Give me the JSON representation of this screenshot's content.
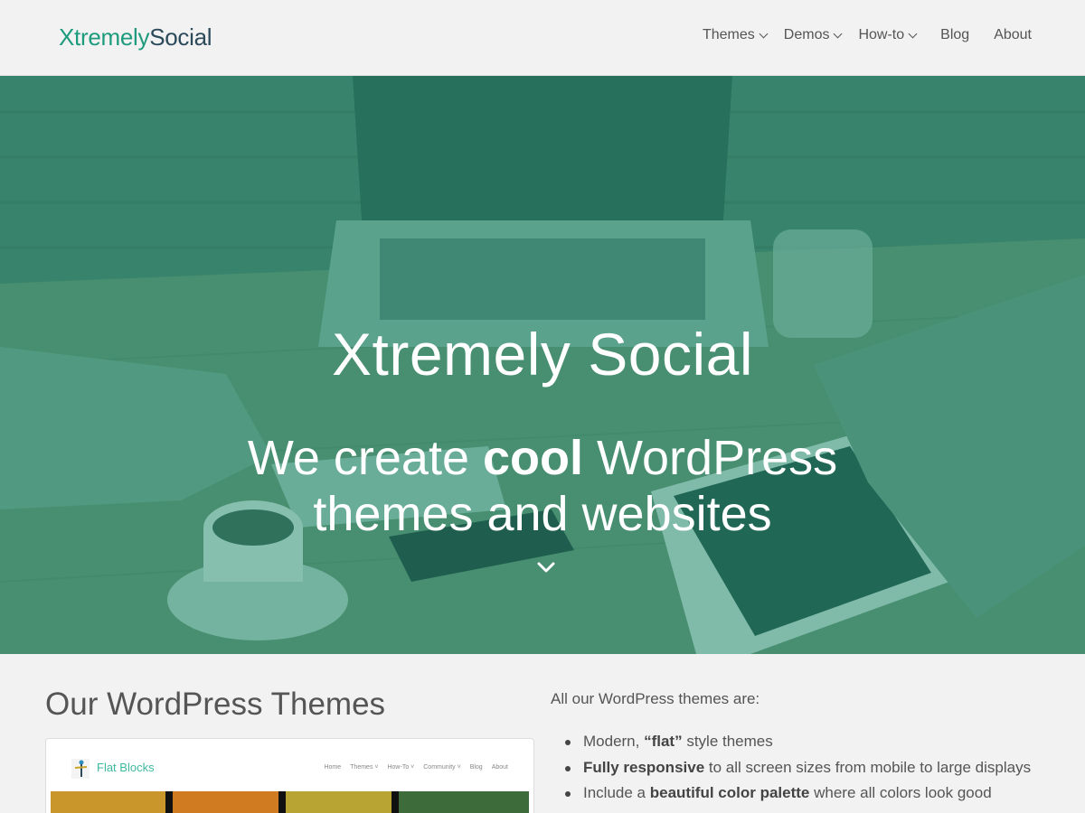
{
  "header": {
    "logo_part1": "Xtremely",
    "logo_part2": "Social",
    "nav": [
      {
        "label": "Themes",
        "has_dropdown": true
      },
      {
        "label": "Demos",
        "has_dropdown": true
      },
      {
        "label": "How-to",
        "has_dropdown": true
      },
      {
        "label": "Blog",
        "has_dropdown": false
      },
      {
        "label": "About",
        "has_dropdown": false
      }
    ]
  },
  "hero": {
    "title": "Xtremely Social",
    "subtitle_pre": "We create ",
    "subtitle_bold": "cool",
    "subtitle_post": " WordPress",
    "subtitle_line2": "themes and websites",
    "scroll_icon": "chevron-down-icon",
    "overlay_color": "#1e8c6e"
  },
  "themes_section": {
    "title": "Our WordPress Themes",
    "preview": {
      "brand": "Flat Blocks",
      "nav": [
        "Home",
        "Themes ˅",
        "How-To ˅",
        "Community ˅",
        "Blog",
        "About"
      ],
      "strip_colors": [
        "#c8962a",
        "#d07a22",
        "#b8a432",
        "#3d6b3a"
      ]
    }
  },
  "features": {
    "intro": "All our WordPress themes are:",
    "items": [
      {
        "pre": "Modern, ",
        "bold": "“flat”",
        "post": " style themes"
      },
      {
        "pre": "",
        "bold": "Fully responsive",
        "post": " to all screen sizes from mobile to large displays"
      },
      {
        "pre": "Include a ",
        "bold": "beautiful color palette",
        "post": " where all colors look good"
      }
    ]
  },
  "colors": {
    "brand_green": "#1e9b7d",
    "brand_dark": "#2c4a5a"
  }
}
